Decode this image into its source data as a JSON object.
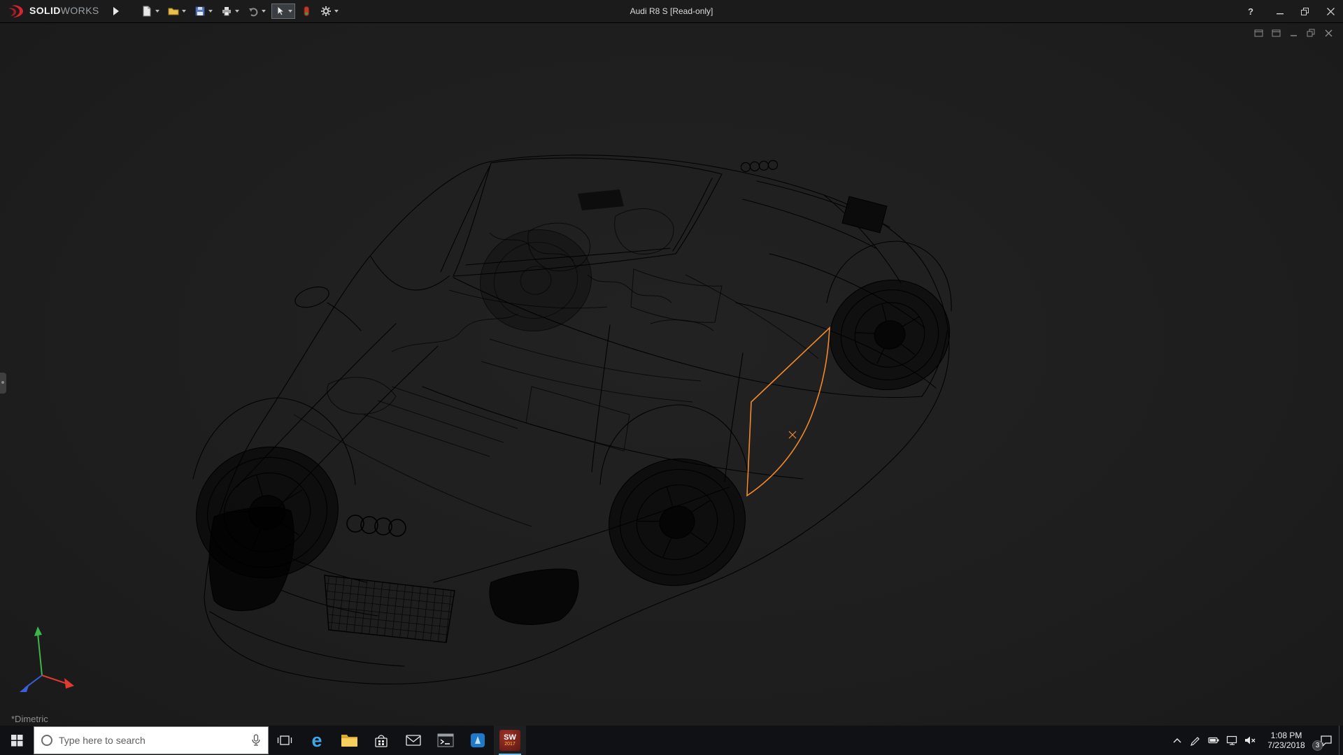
{
  "colors": {
    "viewport_bg": "#1f1f1f",
    "titlebar_bg": "#1b1b1b",
    "taskbar_bg": "#101114",
    "selection_orange": "#f28a2b",
    "logo_red": "#d8242c",
    "edge_blue": "#3fa7e8",
    "folder_yellow": "#f6cf5f"
  },
  "titlebar": {
    "logo_bold": "SOLID",
    "logo_light": "WORKS",
    "document_title": "Audi R8 S [Read-only]",
    "help_label": "?",
    "tools": [
      "new-document-icon",
      "open-folder-icon",
      "save-icon",
      "print-icon",
      "undo-icon",
      "select-cursor-icon",
      "rebuild-icon",
      "options-gear-icon"
    ]
  },
  "viewport": {
    "view_orientation_label": "*Dimetric"
  },
  "taskbar": {
    "search_placeholder": "Type here to search",
    "edge_letter": "e",
    "solidworks_icon_text": "SW",
    "solidworks_icon_year": "2017",
    "clock_time": "1:08 PM",
    "clock_date": "7/23/2018",
    "notification_badge": "3"
  }
}
